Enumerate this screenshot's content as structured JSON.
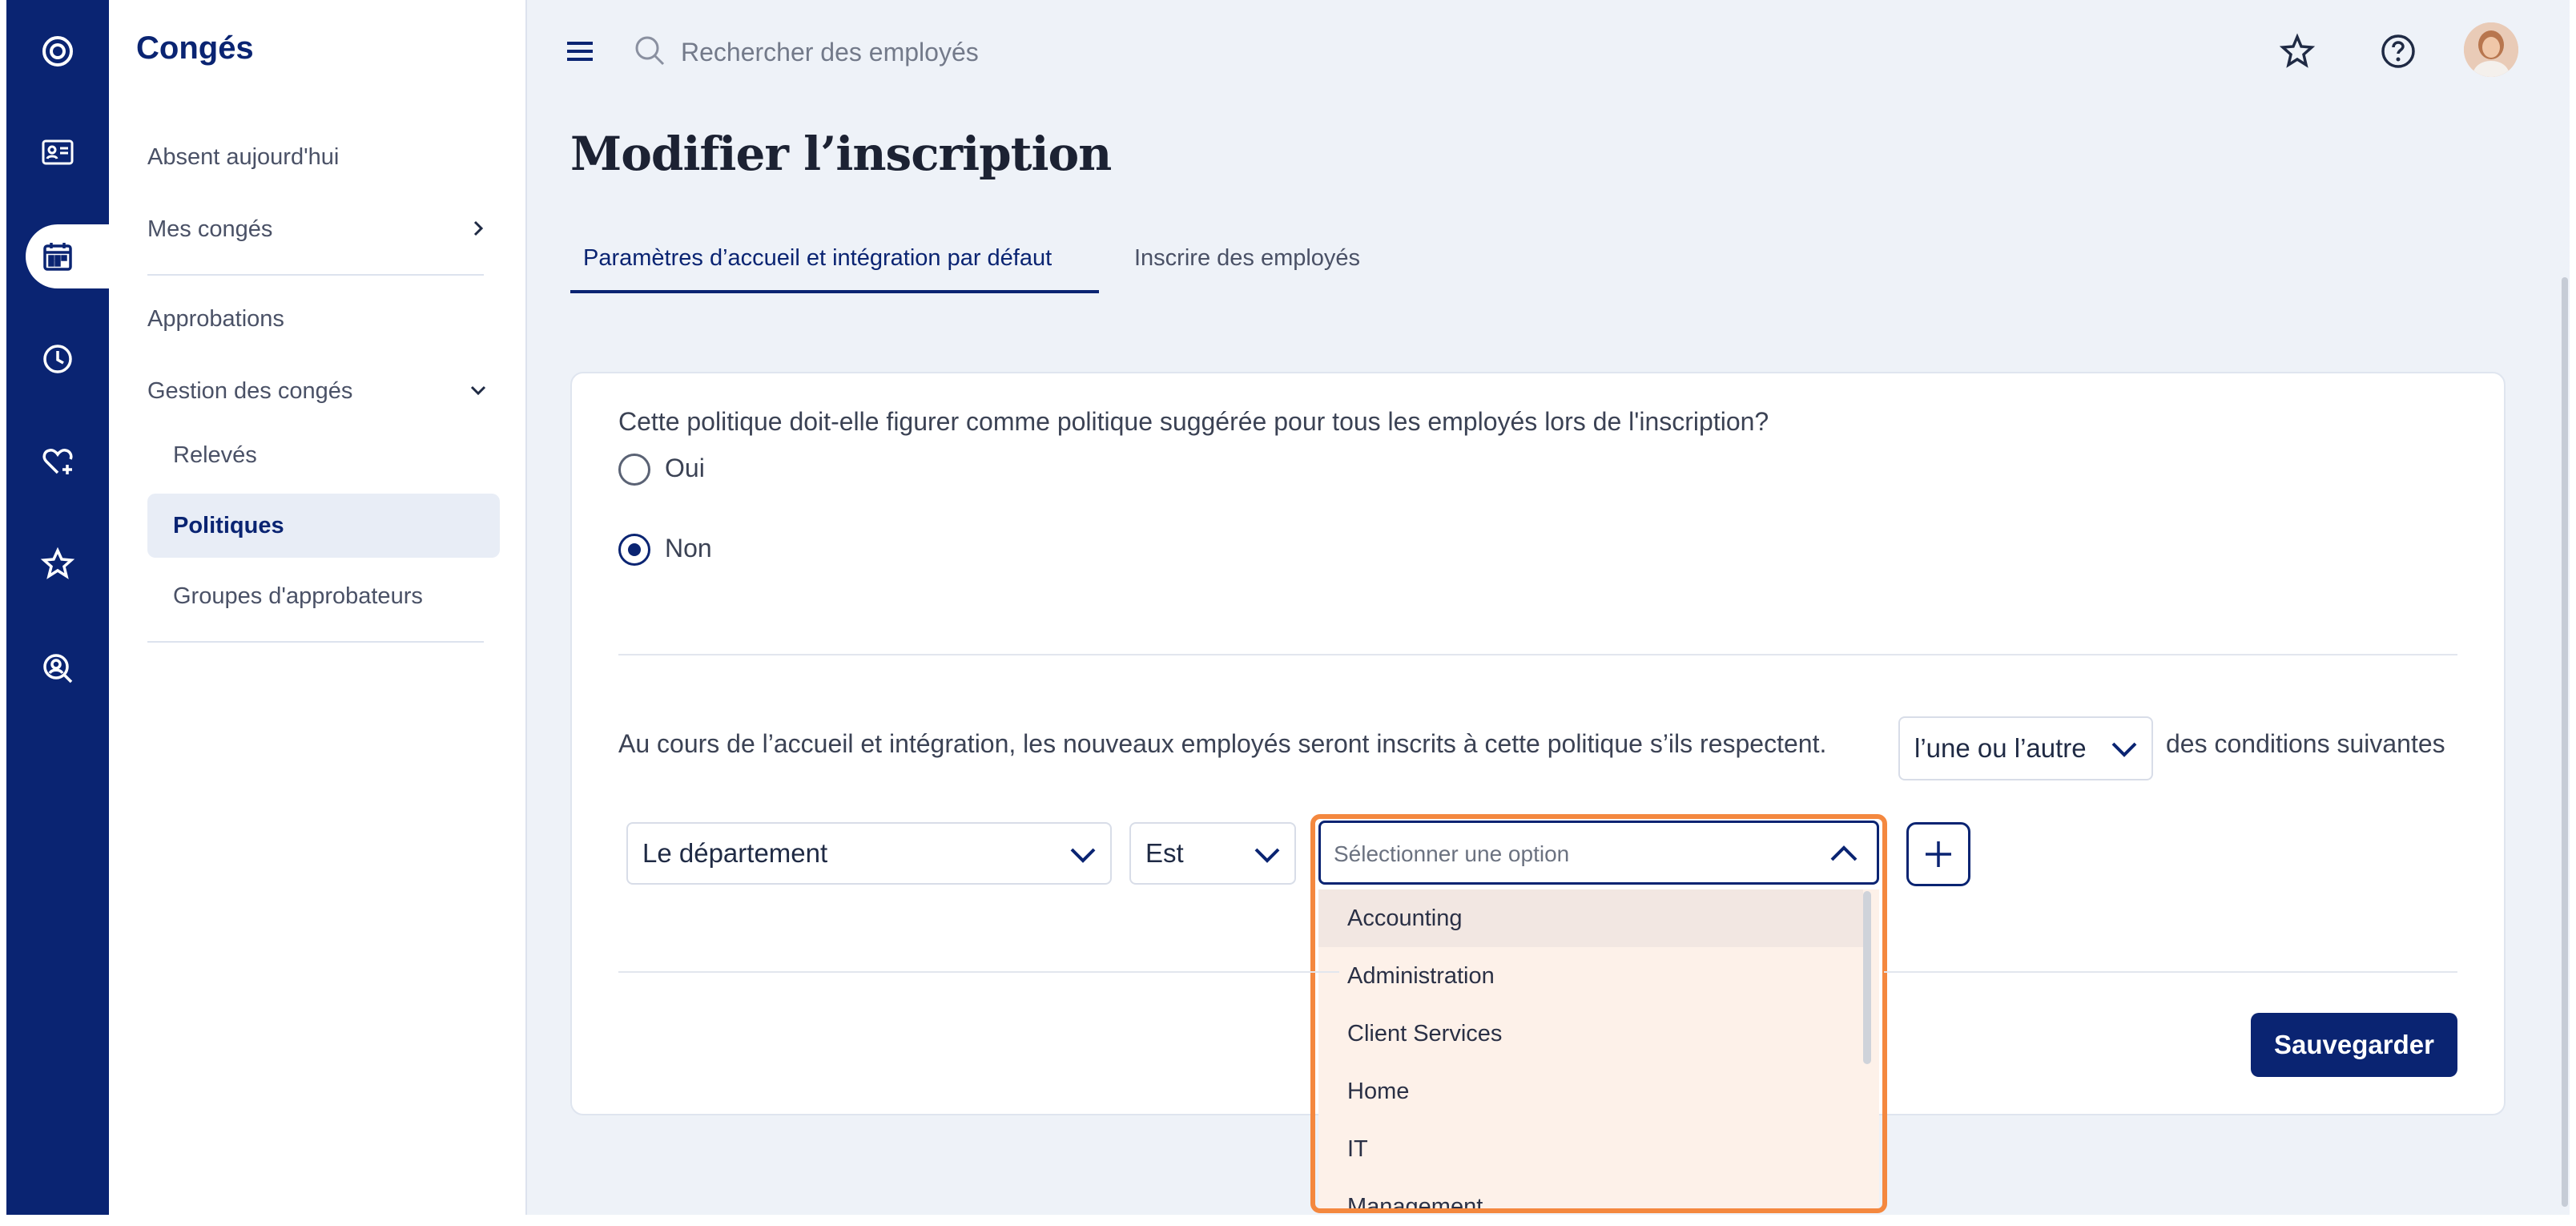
{
  "sidebar": {
    "title": "Congés",
    "items": [
      {
        "label": "Absent aujourd'hui"
      },
      {
        "label": "Mes congés"
      },
      {
        "label": "Approbations"
      },
      {
        "label": "Gestion des congés"
      },
      {
        "label": "Relevés"
      },
      {
        "label": "Politiques"
      },
      {
        "label": "Groupes d'approbateurs"
      }
    ]
  },
  "rail": {
    "icons": [
      "logo-icon",
      "id-card-icon",
      "calendar-icon",
      "clock-icon",
      "heart-plus-icon",
      "star-icon",
      "search-person-icon"
    ]
  },
  "topbar": {
    "search_placeholder": "Rechercher des employés"
  },
  "page": {
    "title": "Modifier l’inscription",
    "tabs": [
      {
        "label": "Paramètres d’accueil et intégration par défaut"
      },
      {
        "label": "Inscrire des employés"
      }
    ]
  },
  "form": {
    "question": "Cette politique doit-elle figurer comme politique suggérée pour tous les employés lors de l'inscription?",
    "options": [
      {
        "label": "Oui",
        "selected": false
      },
      {
        "label": "Non",
        "selected": true
      }
    ],
    "condition_prefix": "Au cours de l’accueil et intégration, les nouveaux employés seront inscrits à cette politique s’ils respectent.",
    "condition_select": "l’une ou l’autre",
    "condition_suffix": "des conditions suivantes",
    "field_select": "Le département",
    "operator_select": "Est",
    "value_placeholder": "Sélectionner une option",
    "value_options": [
      "Accounting",
      "Administration",
      "Client Services",
      "Home",
      "IT",
      "Management"
    ],
    "save_label": "Sauvegarder"
  },
  "colors": {
    "primary": "#0a2472",
    "highlight": "#f4883f",
    "dropdown_bg": "#fdf1e9",
    "page_bg": "#eef2f8"
  }
}
